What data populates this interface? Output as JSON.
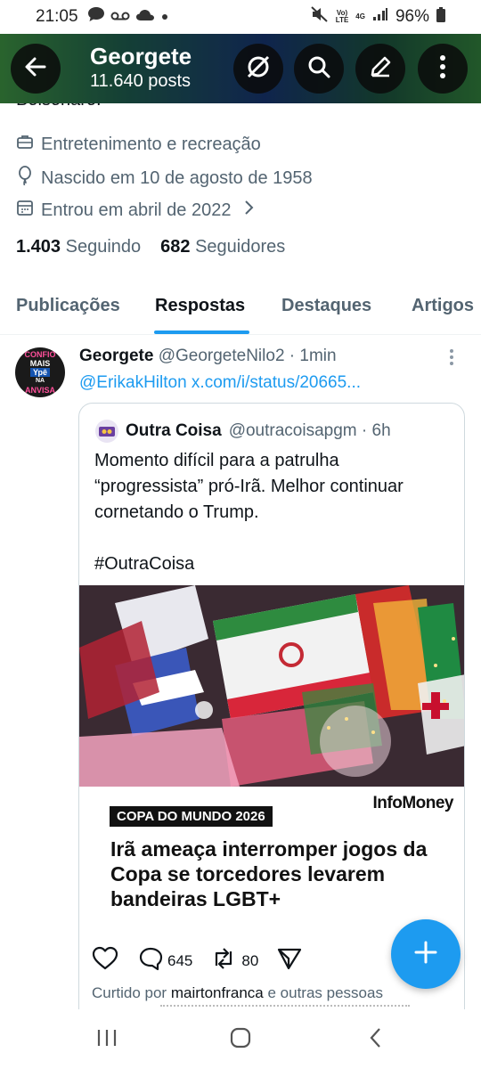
{
  "status_bar": {
    "time": "21:05",
    "signal_top": "Vo)",
    "signal_bottom": "LTE",
    "network": "4G",
    "battery": "96%"
  },
  "header": {
    "name": "Georgete",
    "posts": "11.640 posts"
  },
  "profile": {
    "bio_tail": "Bolsonaro.",
    "category": "Entretenimento e recreação",
    "birthday": "Nascido em 10 de agosto de 1958",
    "joined": "Entrou em abril de 2022",
    "following_count": "1.403",
    "following_label": "Seguindo",
    "followers_count": "682",
    "followers_label": "Seguidores"
  },
  "tabs": [
    {
      "label": "Publicações"
    },
    {
      "label": "Respostas",
      "active": true
    },
    {
      "label": "Destaques"
    },
    {
      "label": "Artigos"
    }
  ],
  "tweet": {
    "avatar_text": [
      "CONFIO",
      "MAIS",
      "Ypê",
      "NA",
      "ANVISA"
    ],
    "author_name": "Georgete",
    "author_handle_time": "@GeorgeteNilo2 · 1min",
    "reply_line": "@ErikakHilton x.com/i/status/20665...",
    "quote": {
      "author_name": "Outra Coisa",
      "author_handle_time": "@outracoisapgm · 6h",
      "text": "Momento difícil para a patrulha “progressista” pró-Irã. Melhor continuar cornetando o Trump.\n\n#OutraCoisa",
      "media": {
        "brand": "InfoMoney",
        "badge": "COPA DO MUNDO 2026",
        "headline": "Irã ameaça interromper jogos da Copa se torcedores levarem bandeiras LGBT+"
      }
    },
    "replies": "645",
    "reposts": "80",
    "liked_by_prefix": "Curtido por ",
    "liked_by_user": "mairtonfranca",
    "liked_by_suffix": " e outras pessoas"
  },
  "colors": {
    "accent": "#1d9bf0",
    "text": "#0f1419",
    "muted": "#536471"
  }
}
